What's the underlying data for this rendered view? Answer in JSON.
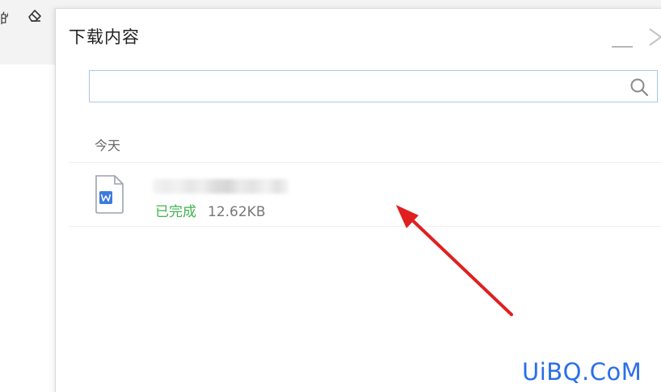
{
  "background": {
    "toolbar_text_fragment": "的",
    "eraser_icon": "eraser-icon"
  },
  "panel": {
    "title": "下载内容",
    "minimize_icon": "minimize-icon",
    "close_icon": "close-icon"
  },
  "search": {
    "value": "",
    "placeholder": "",
    "icon": "search-icon"
  },
  "downloads": {
    "group_label": "今天",
    "items": [
      {
        "icon": "word-document-icon",
        "status": "已完成",
        "size": "12.62KB"
      }
    ]
  },
  "colors": {
    "status_done": "#3fb34f",
    "search_border": "#a9c6e6",
    "file_icon_blue": "#3b7ae0",
    "annotation_arrow": "#e02020",
    "watermark": "#2a6fe8"
  },
  "watermark": {
    "text": "UiBQ.CoM"
  }
}
